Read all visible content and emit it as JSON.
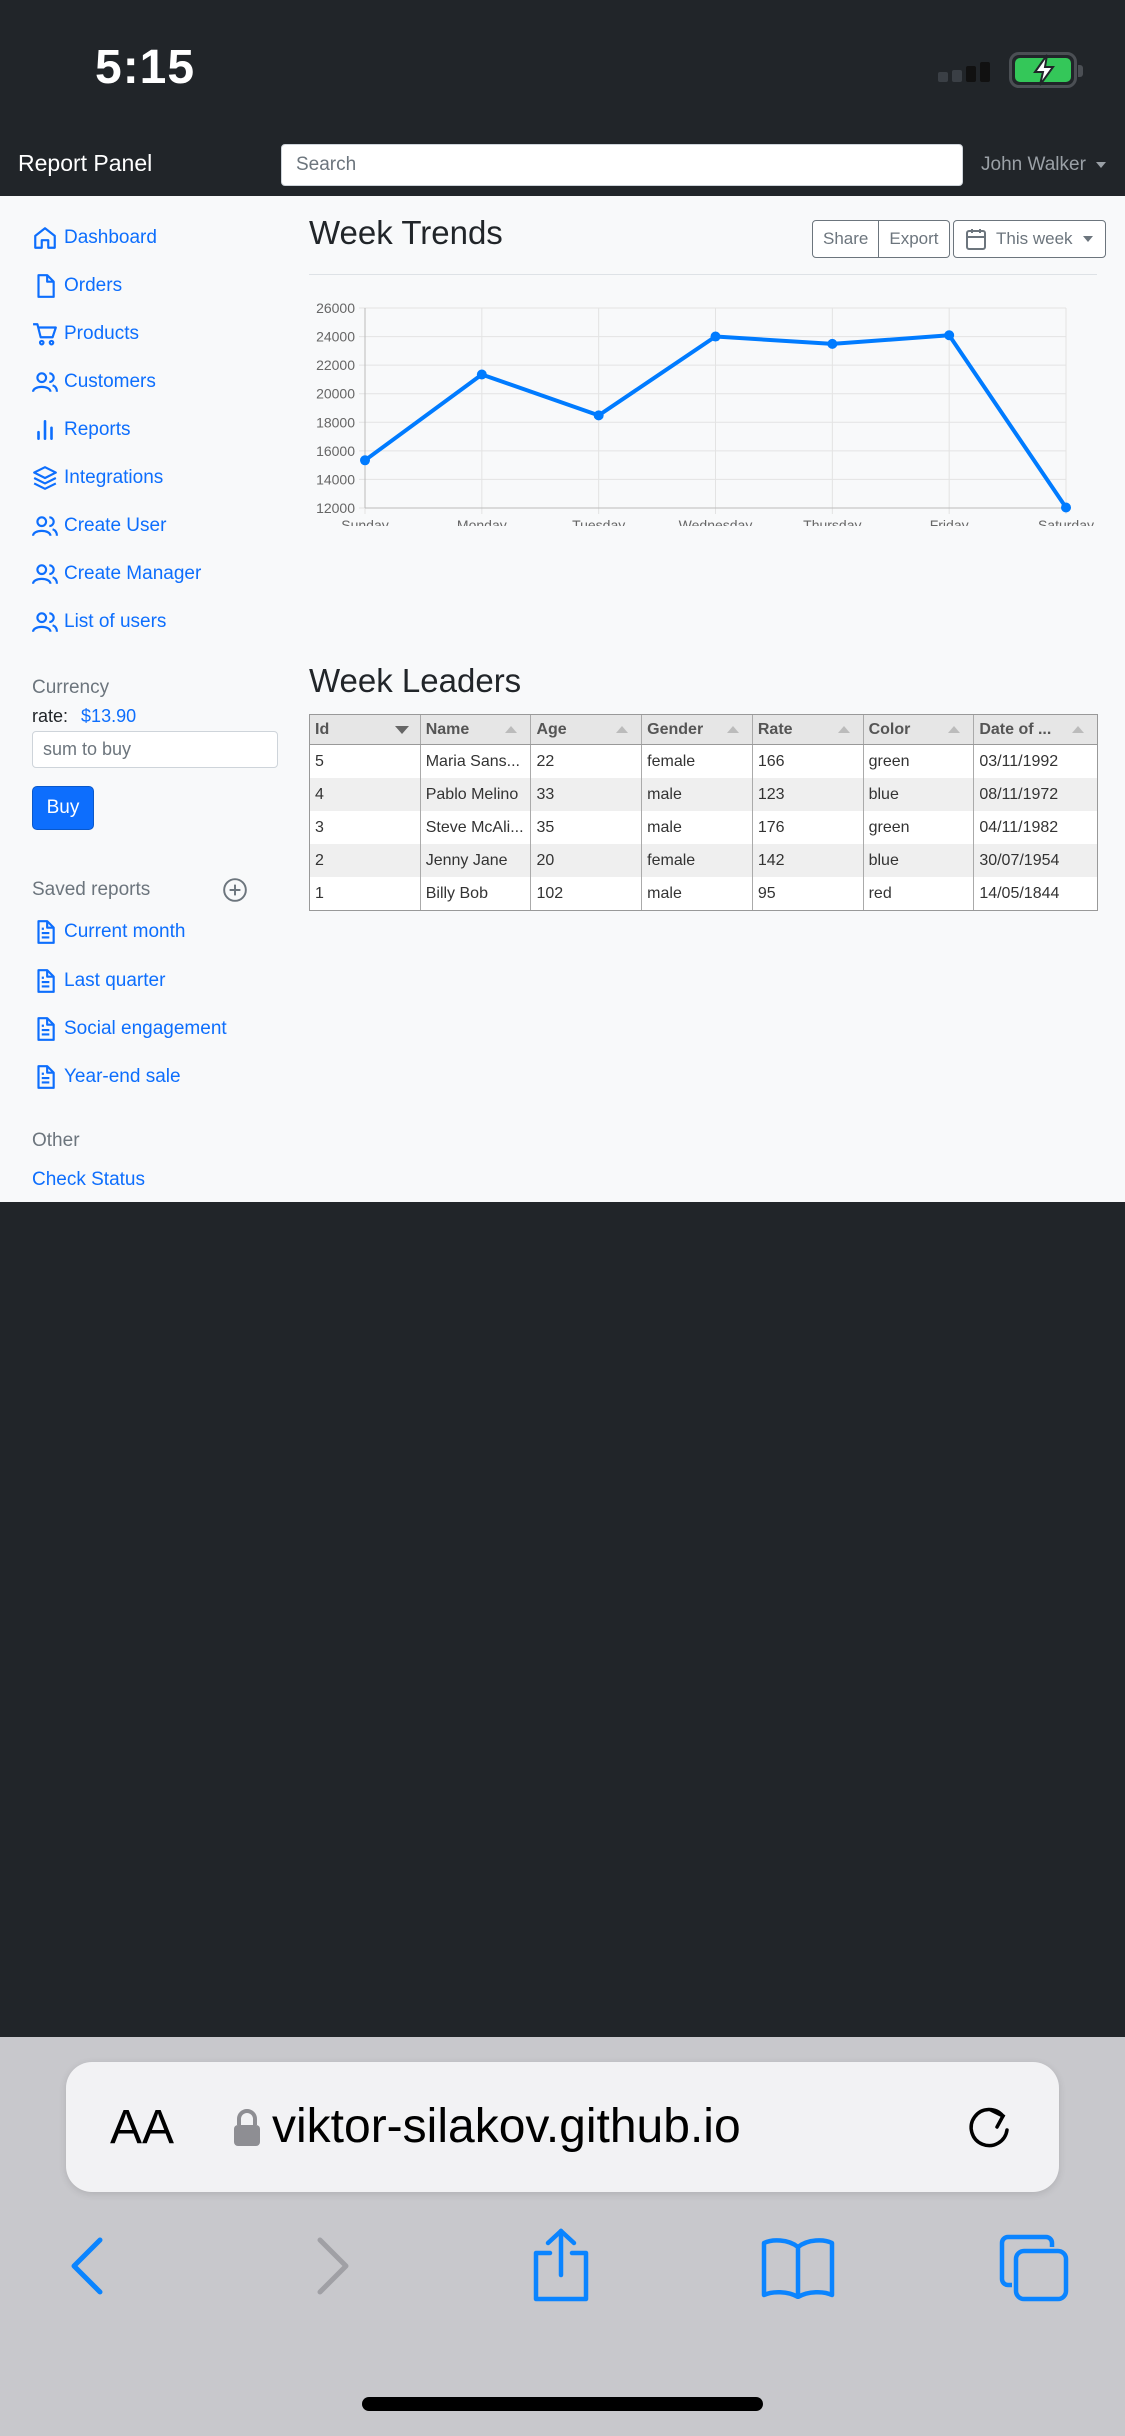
{
  "status_bar": {
    "time": "5:15"
  },
  "navbar": {
    "brand": "Report Panel",
    "search_placeholder": "Search",
    "user": "John Walker"
  },
  "sidebar": {
    "nav": [
      {
        "label": "Dashboard",
        "icon": "home-icon"
      },
      {
        "label": "Orders",
        "icon": "file-icon"
      },
      {
        "label": "Products",
        "icon": "shopping-cart-icon"
      },
      {
        "label": "Customers",
        "icon": "users-icon"
      },
      {
        "label": "Reports",
        "icon": "bar-chart-icon"
      },
      {
        "label": "Integrations",
        "icon": "layers-icon"
      },
      {
        "label": "Create User",
        "icon": "users-icon"
      },
      {
        "label": "Create Manager",
        "icon": "users-icon"
      },
      {
        "label": "List of users",
        "icon": "users-icon"
      }
    ],
    "currency": {
      "heading": "Currency",
      "rate_label": "rate:",
      "rate_value": "$13.90",
      "input_placeholder": "sum to buy",
      "buy_label": "Buy"
    },
    "saved_reports": {
      "heading": "Saved reports",
      "items": [
        {
          "label": "Current month",
          "icon": "file-text-icon"
        },
        {
          "label": "Last quarter",
          "icon": "file-text-icon"
        },
        {
          "label": "Social engagement",
          "icon": "file-text-icon"
        },
        {
          "label": "Year-end sale",
          "icon": "file-text-icon"
        }
      ]
    },
    "other": {
      "heading": "Other",
      "check_status": "Check Status"
    }
  },
  "main": {
    "title": "Week Trends",
    "share_label": "Share",
    "export_label": "Export",
    "period_label": "This week",
    "leaders_title": "Week Leaders"
  },
  "chart_data": {
    "type": "line",
    "categories": [
      "Sunday",
      "Monday",
      "Tuesday",
      "Wednesday",
      "Thursday",
      "Friday",
      "Saturday"
    ],
    "values": [
      15339,
      21345,
      18483,
      24003,
      23489,
      24092,
      12034
    ],
    "ylim": [
      12000,
      26000
    ],
    "yticks": [
      12000,
      14000,
      16000,
      18000,
      20000,
      22000,
      24000,
      26000
    ],
    "color": "#007bff",
    "grid": true,
    "title": "",
    "xlabel": "",
    "ylabel": ""
  },
  "table": {
    "columns": [
      "Id",
      "Name",
      "Age",
      "Gender",
      "Rate",
      "Color",
      "Date of ..."
    ],
    "rows": [
      [
        "5",
        "Maria Sans...",
        "22",
        "female",
        "166",
        "green",
        "03/11/1992"
      ],
      [
        "4",
        "Pablo Melino",
        "33",
        "male",
        "123",
        "blue",
        "08/11/1972"
      ],
      [
        "3",
        "Steve McAli...",
        "35",
        "male",
        "176",
        "green",
        "04/11/1982"
      ],
      [
        "2",
        "Jenny Jane",
        "20",
        "female",
        "142",
        "blue",
        "30/07/1954"
      ],
      [
        "1",
        "Billy Bob",
        "102",
        "male",
        "95",
        "red",
        "14/05/1844"
      ]
    ]
  },
  "safari": {
    "text_size_label": "AA",
    "url": "viktor-silakov.github.io"
  }
}
